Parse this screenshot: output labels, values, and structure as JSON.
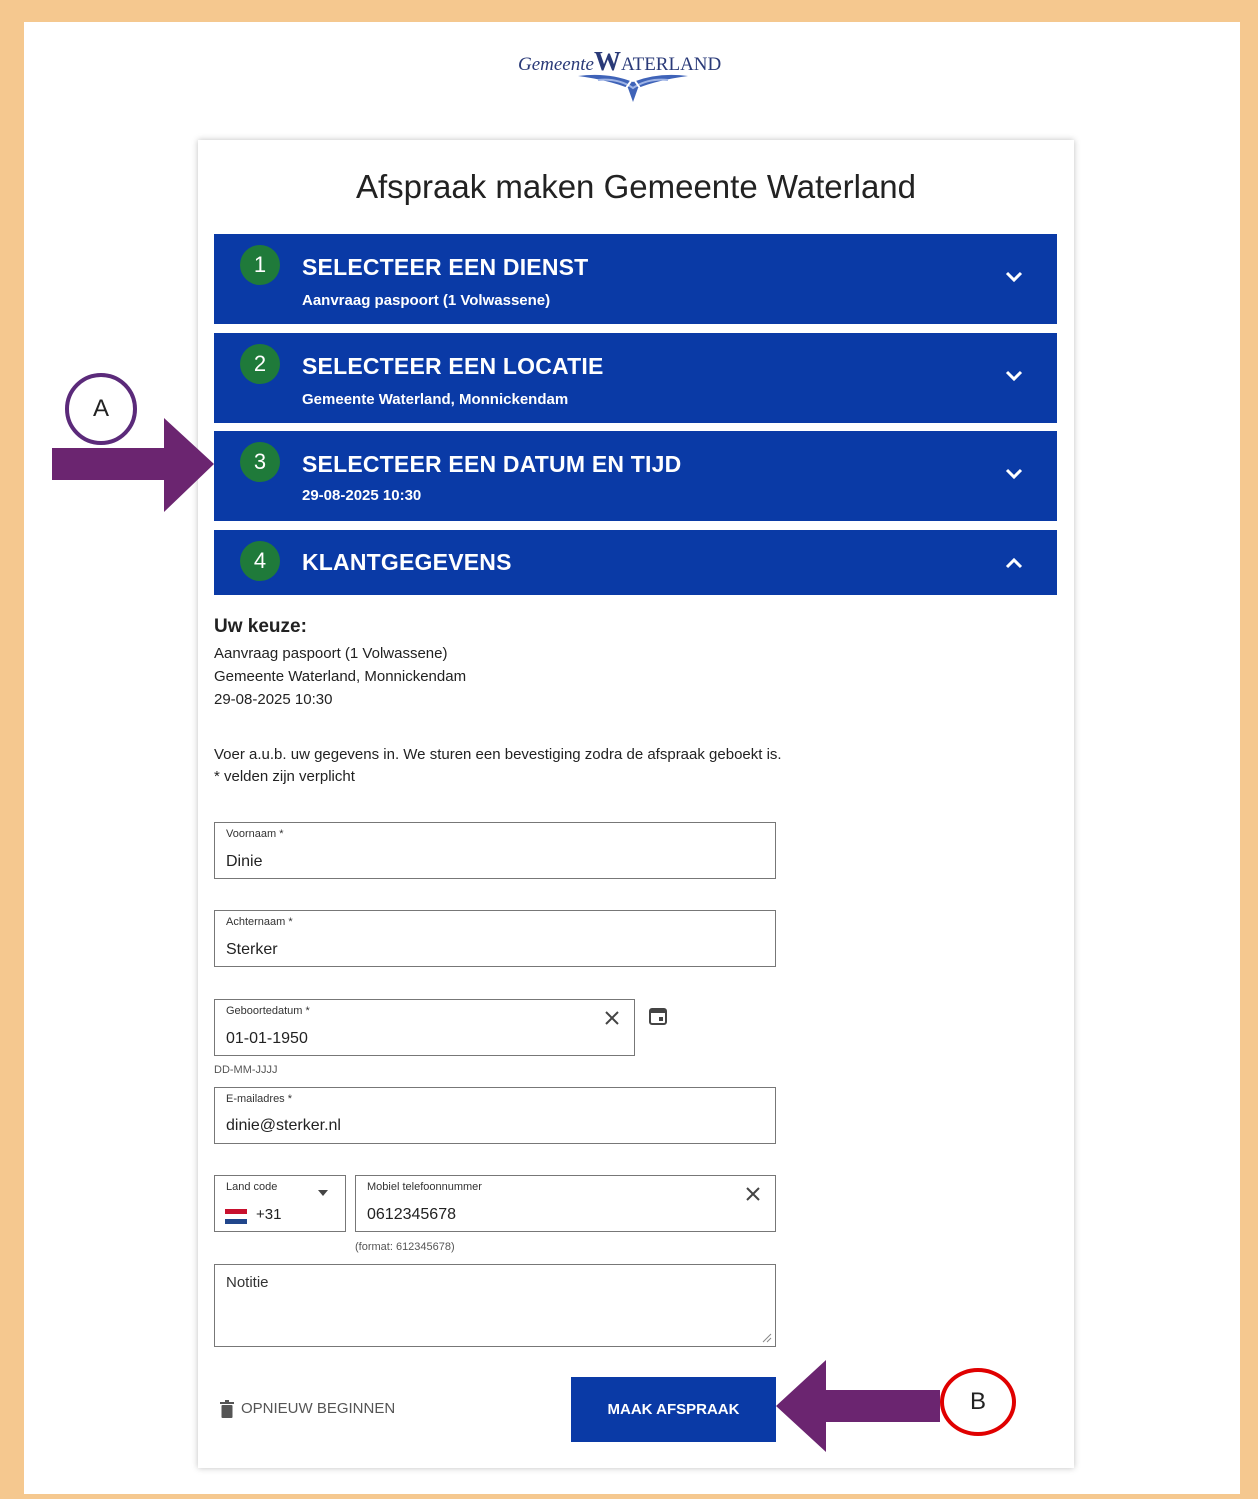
{
  "logo": {
    "prefix": "Gemeente",
    "big_letter": "W",
    "rest": "ATERLAND"
  },
  "page_title": "Afspraak maken Gemeente Waterland",
  "steps": [
    {
      "number": "1",
      "title": "SELECTEER EEN DIENST",
      "subtitle": "Aanvraag paspoort (1 Volwassene)",
      "state": "collapsed"
    },
    {
      "number": "2",
      "title": "SELECTEER EEN LOCATIE",
      "subtitle": "Gemeente Waterland, Monnickendam",
      "state": "collapsed"
    },
    {
      "number": "3",
      "title": "SELECTEER EEN DATUM EN TIJD",
      "subtitle": "29-08-2025 10:30",
      "state": "collapsed"
    },
    {
      "number": "4",
      "title": "KLANTGEGEVENS",
      "subtitle": "",
      "state": "expanded"
    }
  ],
  "choice": {
    "label": "Uw keuze:",
    "lines": [
      "Aanvraag paspoort (1 Volwassene)",
      "Gemeente Waterland, Monnickendam",
      "29-08-2025 10:30"
    ]
  },
  "intro": {
    "line1": "Voer a.u.b. uw gegevens in. We sturen een bevestiging zodra de afspraak geboekt is.",
    "line2": "* velden zijn verplicht"
  },
  "form": {
    "first_name": {
      "label": "Voornaam *",
      "value": "Dinie"
    },
    "last_name": {
      "label": "Achternaam *",
      "value": "Sterker"
    },
    "birth_date": {
      "label": "Geboortedatum *",
      "value": "01-01-1950",
      "hint": "DD-MM-JJJJ"
    },
    "email": {
      "label": "E-mailadres *",
      "value": "dinie@sterker.nl"
    },
    "country_code": {
      "label": "Land code",
      "value": "+31"
    },
    "phone": {
      "label": "Mobiel telefoonnummer",
      "value": "0612345678",
      "hint": "(format: 612345678)"
    },
    "note": {
      "placeholder": "Notitie"
    }
  },
  "actions": {
    "reset_label": "OPNIEUW BEGINNEN",
    "submit_label": "MAAK AFSPRAAK"
  },
  "annotations": {
    "a": "A",
    "b": "B"
  },
  "colors": {
    "primary": "#0a3aa6",
    "step_badge": "#1f7a3a",
    "arrow": "#6b2570",
    "frame": "#f5c88f",
    "circle_a": "#5b2a7a",
    "circle_b": "#e00000"
  }
}
